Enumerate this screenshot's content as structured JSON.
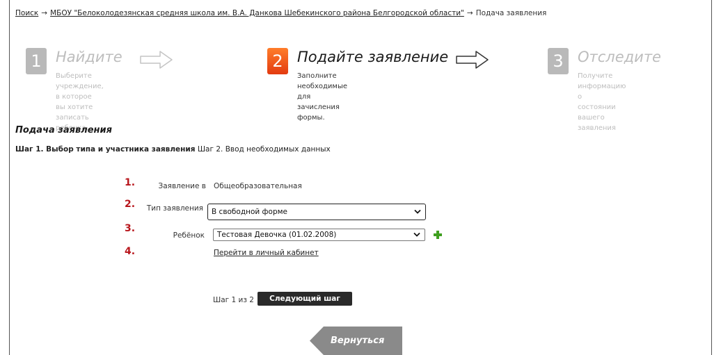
{
  "breadcrumb": {
    "items": [
      "Поиск",
      "МБОУ \"Белоколодезянская средняя школа им. В.А. Данкова Шебекинского района Белгородской области\"",
      "Подача заявления"
    ],
    "separator": "→"
  },
  "steps": [
    {
      "number": "1",
      "title": "Найдите",
      "desc_line1": "Выберите учреждение, в которое",
      "desc_line2": "вы хотите записать ребенка.",
      "state": "inactive"
    },
    {
      "number": "2",
      "title": "Подайте заявление",
      "desc_line1": "Заполните необходимые для",
      "desc_line2": "зачисления формы.",
      "state": "active"
    },
    {
      "number": "3",
      "title": "Отследите",
      "desc_line1": "Получите информацию о",
      "desc_line2": "состоянии вашего заявления",
      "state": "inactive"
    }
  ],
  "section_title": "Подача заявления",
  "substeps": {
    "current": "Шаг 1. Выбор типа и участника заявления",
    "next": "Шаг 2. Ввод необходимых данных"
  },
  "form": {
    "rows": [
      {
        "num": "1.",
        "label": "Заявление в",
        "value": "Общеобразовательная"
      },
      {
        "num": "2.",
        "label": "Тип заявления",
        "value": "В свободной форме"
      },
      {
        "num": "3.",
        "label": "Ребёнок",
        "value": "Тестовая Девочка (01.02.2008)"
      },
      {
        "num": "4.",
        "link": "Перейти в личный кабинет"
      }
    ]
  },
  "footer": {
    "step_counter": "Шаг 1 из 2",
    "next_button": "Следующий шаг",
    "back_button": "Вернуться"
  },
  "colors": {
    "active_step": "#e9461a",
    "inactive_step": "#b9b9b9",
    "row_number": "#b8161c",
    "plus_icon": "#3f9f1f",
    "next_button_bg": "#2a2a2a",
    "back_button_bg": "#8a8a8a"
  },
  "icons": {
    "step_arrow": "outline-arrow-right-icon",
    "add_child": "plus-icon",
    "dropdown": "chevron-down-icon"
  }
}
